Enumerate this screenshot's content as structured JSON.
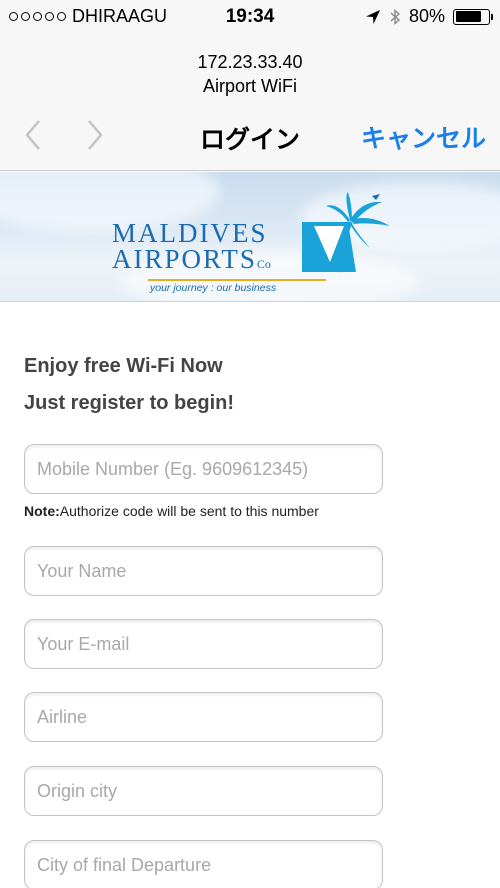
{
  "status_bar": {
    "carrier": "DHIRAAGU",
    "time": "19:34",
    "battery_percent": "80%",
    "battery_level": 0.8,
    "icons": [
      "signal-dots-icon",
      "location-arrow-icon",
      "bluetooth-icon",
      "battery-icon"
    ]
  },
  "nav": {
    "host": "172.23.33.40",
    "ssid": "Airport WiFi",
    "title": "ログイン",
    "cancel_label": "キャンセル",
    "back_icon": "chevron-left-icon",
    "forward_icon": "chevron-right-icon"
  },
  "banner": {
    "logo_line1": "MALDIVES",
    "logo_line2": "AIRPORTS",
    "logo_co": "Co",
    "tagline": "your journey : our business",
    "colors": {
      "brand_blue": "#1a6bb2",
      "accent_gold": "#e0b020",
      "mark_cyan": "#1aa3d9"
    }
  },
  "form": {
    "headline1": "Enjoy free Wi-Fi Now",
    "headline2": "Just register to begin!",
    "mobile_placeholder": "Mobile Number (Eg. 9609612345)",
    "note_label": "Note:",
    "note_text": "Authorize code will be sent to this number",
    "name_placeholder": "Your Name",
    "email_placeholder": "Your E-mail",
    "airline_placeholder": "Airline",
    "origin_placeholder": "Origin city",
    "departure_placeholder": "City of final Departure"
  },
  "colors": {
    "ios_blue": "#1a7fe8"
  }
}
